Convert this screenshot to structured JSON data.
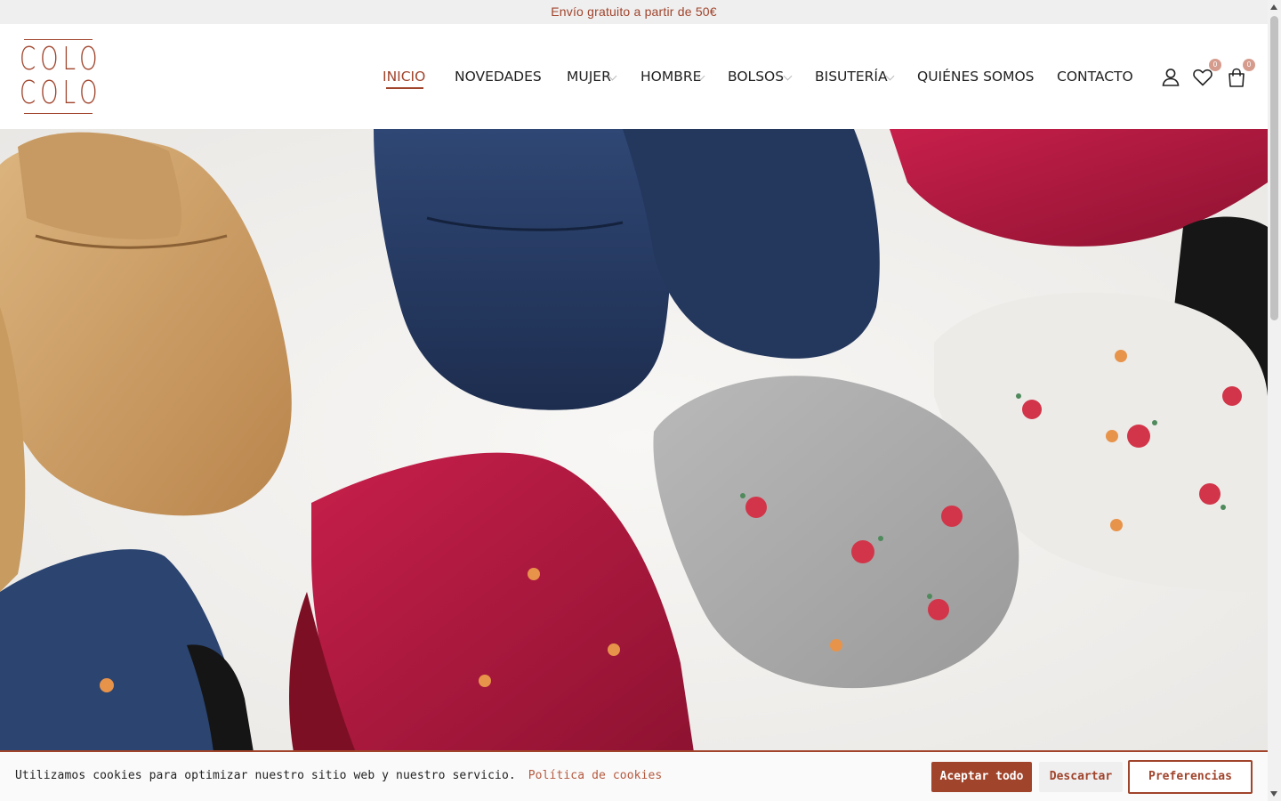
{
  "announcement": "Envío gratuito a partir de 50€",
  "brand": {
    "logo_line1": "COLO",
    "logo_line2": "COLO",
    "accent_color": "#a0442c"
  },
  "nav": {
    "items": [
      {
        "label": "INICIO",
        "active": true,
        "has_dropdown": false
      },
      {
        "label": "NOVEDADES",
        "active": false,
        "has_dropdown": false
      },
      {
        "label": "MUJER",
        "active": false,
        "has_dropdown": true
      },
      {
        "label": "HOMBRE",
        "active": false,
        "has_dropdown": true
      },
      {
        "label": "BOLSOS",
        "active": false,
        "has_dropdown": true
      },
      {
        "label": "BISUTERÍA",
        "active": false,
        "has_dropdown": true
      },
      {
        "label": "QUIÉNES SOMOS",
        "active": false,
        "has_dropdown": false
      },
      {
        "label": "CONTACTO",
        "active": false,
        "has_dropdown": false
      }
    ]
  },
  "header_icons": {
    "account_icon": "user-icon",
    "wishlist_icon": "heart-icon",
    "wishlist_count": "0",
    "cart_icon": "shopping-bag-icon",
    "cart_count": "0"
  },
  "cookie_banner": {
    "message": "Utilizamos cookies para optimizar nuestro sitio web y nuestro servicio.",
    "policy_link": "Política de cookies",
    "accept_label": "Aceptar todo",
    "dismiss_label": "Descartar",
    "preferences_label": "Preferencias"
  }
}
